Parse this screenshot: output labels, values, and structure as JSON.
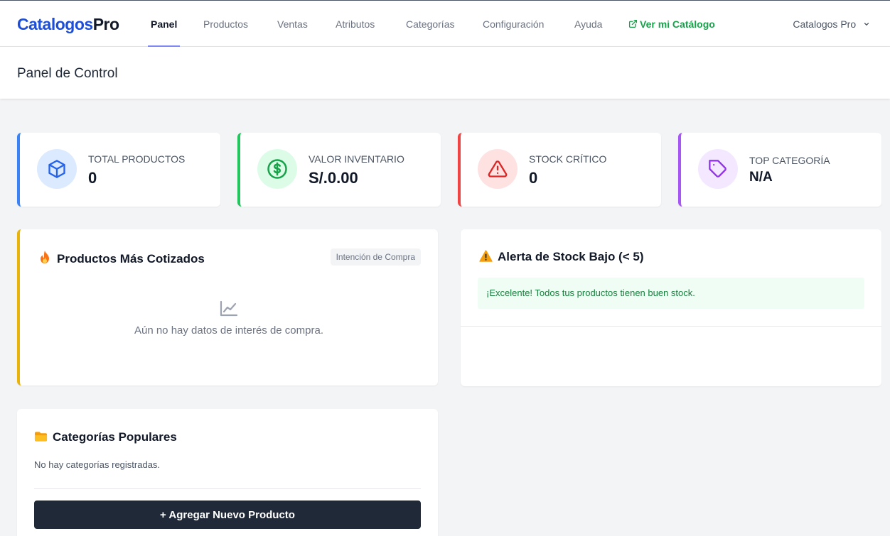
{
  "brand": {
    "name_part1": "Catalogos",
    "name_part2": "Pro"
  },
  "nav": {
    "items": [
      {
        "label": "Panel",
        "active": true
      },
      {
        "label": "Productos"
      },
      {
        "label": "Ventas"
      },
      {
        "label": "Atributos"
      },
      {
        "label": "Categorías"
      },
      {
        "label": "Configuración"
      },
      {
        "label": "Ayuda"
      }
    ],
    "external_link": {
      "label": "Ver mi Catálogo",
      "icon": "external-link-icon"
    },
    "user_menu": {
      "label": "Catalogos Pro",
      "icon": "chevron-down-icon"
    }
  },
  "page": {
    "title": "Panel de Control"
  },
  "stats": [
    {
      "label": "Total Productos",
      "value": "0",
      "icon": "cube-icon",
      "accent": "#3b82f6",
      "icon_bg": "#dbeafe",
      "icon_color": "#2563eb"
    },
    {
      "label": "Valor Inventario",
      "value": "S/.0.00",
      "icon": "dollar-icon",
      "accent": "#22c55e",
      "icon_bg": "#dcfce7",
      "icon_color": "#16a34a"
    },
    {
      "label": "Stock Crítico",
      "value": "0",
      "icon": "warning-icon",
      "accent": "#ef4444",
      "icon_bg": "#fee2e2",
      "icon_color": "#dc2626"
    },
    {
      "label": "Top Categoría",
      "value": "N/A",
      "icon": "tag-icon",
      "accent": "#a855f7",
      "icon_bg": "#f3e8ff",
      "icon_color": "#9333ea"
    }
  ],
  "top_quoted": {
    "title": "Productos Más Cotizados",
    "icon": "fire-icon",
    "badge": "Intención de Compra",
    "empty_icon": "chart-line-icon",
    "empty_text": "Aún no hay datos de interés de compra.",
    "accent": "#eab308"
  },
  "stock_alert": {
    "title": "Alerta de Stock Bajo (< 5)",
    "icon": "warning-icon",
    "message": "¡Excelente! Todos tus productos tienen buen stock."
  },
  "popular_categories": {
    "title": "Categorías Populares",
    "icon": "folder-icon",
    "empty_text": "No hay categorías registradas.",
    "button_label": "+ Agregar Nuevo Producto"
  }
}
